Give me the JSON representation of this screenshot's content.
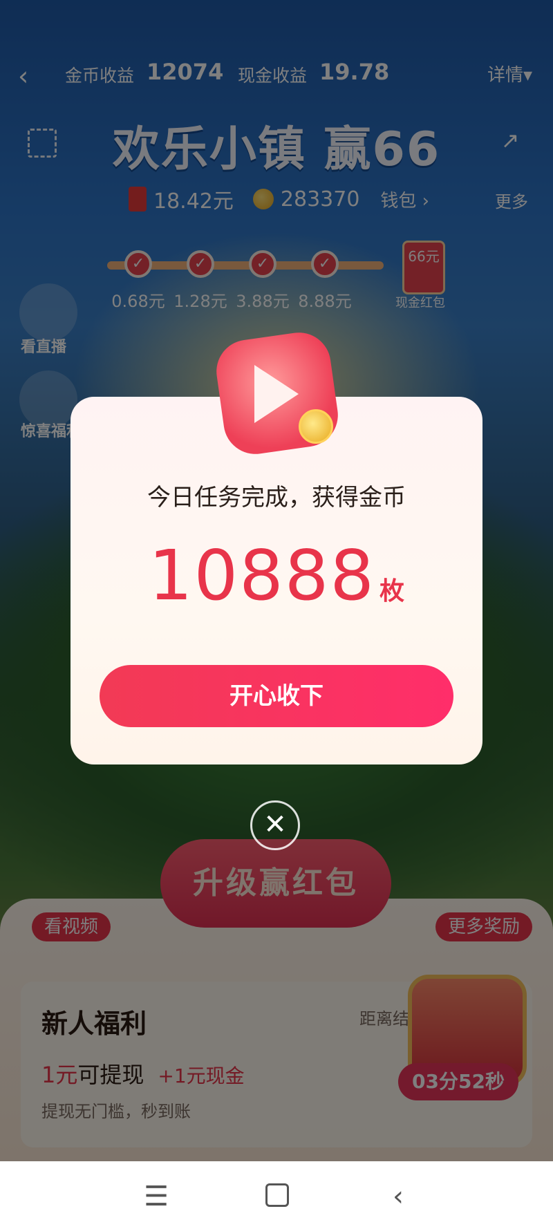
{
  "header": {
    "back_glyph": "‹",
    "coin_income_label": "金币收益",
    "coin_income_value": "12074",
    "cash_income_label": "现金收益",
    "cash_income_value": "19.78",
    "detail_label": "详情▾",
    "title": "欢乐小镇 赢66",
    "share_glyph": "↗",
    "cash_balance": "18.42元",
    "coin_balance": "283370",
    "wallet_label": "钱包 ›",
    "more_label": "更多"
  },
  "progress": {
    "milestones": [
      "0.68元",
      "1.28元",
      "3.88元",
      "8.88元"
    ],
    "grand_prize": "66元",
    "grand_prize_label": "现金红包",
    "check_glyph": "✓"
  },
  "side": {
    "live_label": "看直播",
    "surprise_label": "惊喜福利"
  },
  "bottom": {
    "upgrade_label": "升级赢红包",
    "watch_video_label": "看视频",
    "more_rewards_label": "更多奖励",
    "newbie_title": "新人福利",
    "newbie_side": "距离结束",
    "newbie_withdraw_red": "1元",
    "newbie_withdraw_rest": "可提现",
    "newbie_extra": "+1元现金",
    "newbie_desc": "提现无门槛，秒到账",
    "countdown": "03分52秒"
  },
  "dialog": {
    "message": "今日任务完成，获得金币",
    "amount": "10888",
    "unit": "枚",
    "confirm_label": "开心收下",
    "close_glyph": "✕"
  },
  "navbar": {
    "menu_glyph": "☰",
    "back_glyph": "‹"
  },
  "colors": {
    "accent_red": "#e8344a",
    "dialog_bg": "#fff6f1"
  }
}
